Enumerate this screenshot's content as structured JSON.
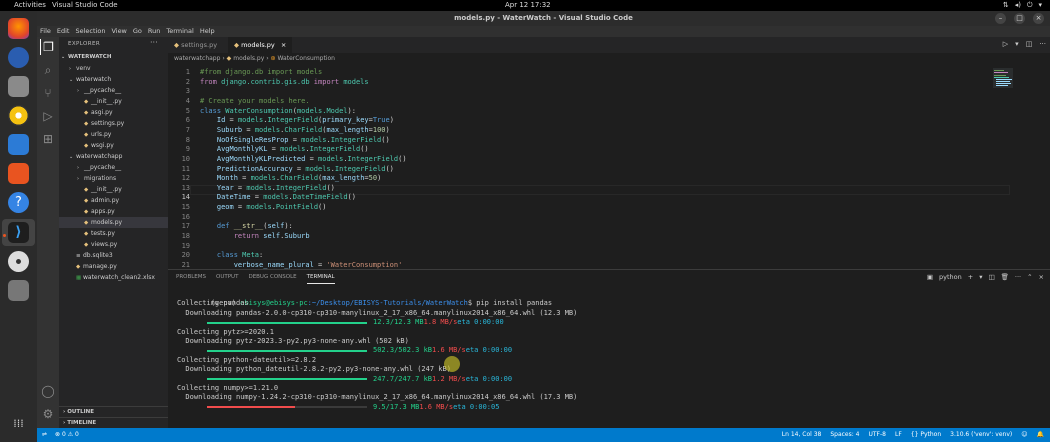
{
  "gnome": {
    "activities": "Activities",
    "app_name": "Visual Studio Code",
    "clock": "Apr 12  17:32"
  },
  "window": {
    "title": "models.py - WaterWatch - Visual Studio Code"
  },
  "menu": [
    "File",
    "Edit",
    "Selection",
    "View",
    "Go",
    "Run",
    "Terminal",
    "Help"
  ],
  "sidebar": {
    "title": "EXPLORER",
    "items": [
      {
        "label": "WATERWATCH",
        "chevron": "v",
        "indent": 0,
        "bold": true
      },
      {
        "label": "venv",
        "chevron": ">",
        "indent": 1
      },
      {
        "label": "waterwatch",
        "chevron": "v",
        "indent": 1
      },
      {
        "label": "__pycache__",
        "chevron": ">",
        "indent": 2
      },
      {
        "label": "__init__.py",
        "icon": "py",
        "indent": 2
      },
      {
        "label": "asgi.py",
        "icon": "py",
        "indent": 2
      },
      {
        "label": "settings.py",
        "icon": "py",
        "indent": 2
      },
      {
        "label": "urls.py",
        "icon": "py",
        "indent": 2
      },
      {
        "label": "wsgi.py",
        "icon": "py",
        "indent": 2
      },
      {
        "label": "waterwatchapp",
        "chevron": "v",
        "indent": 1
      },
      {
        "label": "__pycache__",
        "chevron": ">",
        "indent": 2
      },
      {
        "label": "migrations",
        "chevron": ">",
        "indent": 2
      },
      {
        "label": "__init__.py",
        "icon": "py",
        "indent": 2
      },
      {
        "label": "admin.py",
        "icon": "py",
        "indent": 2
      },
      {
        "label": "apps.py",
        "icon": "py",
        "indent": 2
      },
      {
        "label": "models.py",
        "icon": "py",
        "indent": 2,
        "selected": true
      },
      {
        "label": "tests.py",
        "icon": "py",
        "indent": 2
      },
      {
        "label": "views.py",
        "icon": "py",
        "indent": 2
      },
      {
        "label": "db.sqlite3",
        "icon": "db",
        "indent": 1
      },
      {
        "label": "manage.py",
        "icon": "py",
        "indent": 1
      },
      {
        "label": "waterwatch_clean2.xlsx",
        "icon": "xlsx",
        "indent": 1
      }
    ],
    "outline": "OUTLINE",
    "timeline": "TIMELINE"
  },
  "tabs": [
    {
      "label": "settings.py",
      "active": false
    },
    {
      "label": "models.py",
      "active": true
    }
  ],
  "breadcrumb": [
    "waterwatchapp",
    "models.py",
    "WaterConsumption"
  ],
  "code": [
    [
      [
        "cmt",
        "#from django.db import models"
      ]
    ],
    [
      [
        "k1",
        "from "
      ],
      [
        "cls",
        "django.contrib.gis.db"
      ],
      [
        "k1",
        " import "
      ],
      [
        "cls",
        "models"
      ]
    ],
    [],
    [
      [
        "cmt",
        "# Create your models here."
      ]
    ],
    [
      [
        "k2",
        "class "
      ],
      [
        "cls",
        "WaterConsumption"
      ],
      [
        "pl",
        "("
      ],
      [
        "cls",
        "models.Model"
      ],
      [
        "pl",
        "):"
      ]
    ],
    [
      [
        "pl",
        "    "
      ],
      [
        "var",
        "Id"
      ],
      [
        "pl",
        " = "
      ],
      [
        "cls",
        "models"
      ],
      [
        "pl",
        "."
      ],
      [
        "cls",
        "IntegerField"
      ],
      [
        "pl",
        "("
      ],
      [
        "var",
        "primary_key"
      ],
      [
        "pl",
        "="
      ],
      [
        "k2",
        "True"
      ],
      [
        "pl",
        ")"
      ]
    ],
    [
      [
        "pl",
        "    "
      ],
      [
        "var",
        "Suburb"
      ],
      [
        "pl",
        " = "
      ],
      [
        "cls",
        "models"
      ],
      [
        "pl",
        "."
      ],
      [
        "cls",
        "CharField"
      ],
      [
        "pl",
        "("
      ],
      [
        "var",
        "max_length"
      ],
      [
        "pl",
        "="
      ],
      [
        "num",
        "100"
      ],
      [
        "pl",
        ")"
      ]
    ],
    [
      [
        "pl",
        "    "
      ],
      [
        "var",
        "NoOfSingleResProp"
      ],
      [
        "pl",
        " = "
      ],
      [
        "cls",
        "models"
      ],
      [
        "pl",
        "."
      ],
      [
        "cls",
        "IntegerField"
      ],
      [
        "pl",
        "()"
      ]
    ],
    [
      [
        "pl",
        "    "
      ],
      [
        "var",
        "AvgMonthlyKL"
      ],
      [
        "pl",
        " = "
      ],
      [
        "cls",
        "models"
      ],
      [
        "pl",
        "."
      ],
      [
        "cls",
        "IntegerField"
      ],
      [
        "pl",
        "()"
      ]
    ],
    [
      [
        "pl",
        "    "
      ],
      [
        "var",
        "AvgMonthlyKLPredicted"
      ],
      [
        "pl",
        " = "
      ],
      [
        "cls",
        "models"
      ],
      [
        "pl",
        "."
      ],
      [
        "cls",
        "IntegerField"
      ],
      [
        "pl",
        "()"
      ]
    ],
    [
      [
        "pl",
        "    "
      ],
      [
        "var",
        "PredictionAccuracy"
      ],
      [
        "pl",
        " = "
      ],
      [
        "cls",
        "models"
      ],
      [
        "pl",
        "."
      ],
      [
        "cls",
        "IntegerField"
      ],
      [
        "pl",
        "()"
      ]
    ],
    [
      [
        "pl",
        "    "
      ],
      [
        "var",
        "Month"
      ],
      [
        "pl",
        " = "
      ],
      [
        "cls",
        "models"
      ],
      [
        "pl",
        "."
      ],
      [
        "cls",
        "CharField"
      ],
      [
        "pl",
        "("
      ],
      [
        "var",
        "max_length"
      ],
      [
        "pl",
        "="
      ],
      [
        "num",
        "50"
      ],
      [
        "pl",
        ")"
      ]
    ],
    [
      [
        "pl",
        "    "
      ],
      [
        "var",
        "Year"
      ],
      [
        "pl",
        " = "
      ],
      [
        "cls",
        "models"
      ],
      [
        "pl",
        "."
      ],
      [
        "cls",
        "IntegerField"
      ],
      [
        "pl",
        "()"
      ]
    ],
    [
      [
        "pl",
        "    "
      ],
      [
        "var",
        "DateTime"
      ],
      [
        "pl",
        " = "
      ],
      [
        "cls",
        "models"
      ],
      [
        "pl",
        "."
      ],
      [
        "cls",
        "DateTimeField"
      ],
      [
        "pl",
        "()"
      ]
    ],
    [
      [
        "pl",
        "    "
      ],
      [
        "var",
        "geom"
      ],
      [
        "pl",
        " = "
      ],
      [
        "cls",
        "models"
      ],
      [
        "pl",
        "."
      ],
      [
        "cls",
        "PointField"
      ],
      [
        "pl",
        "()"
      ]
    ],
    [],
    [
      [
        "pl",
        "    "
      ],
      [
        "k2",
        "def "
      ],
      [
        "fn",
        "__str__"
      ],
      [
        "pl",
        "("
      ],
      [
        "var",
        "self"
      ],
      [
        "pl",
        "):"
      ]
    ],
    [
      [
        "pl",
        "        "
      ],
      [
        "k1",
        "return "
      ],
      [
        "var",
        "self"
      ],
      [
        "pl",
        "."
      ],
      [
        "var",
        "Suburb"
      ]
    ],
    [],
    [
      [
        "pl",
        "    "
      ],
      [
        "k2",
        "class "
      ],
      [
        "cls",
        "Meta"
      ],
      [
        "pl",
        ":"
      ]
    ],
    [
      [
        "pl",
        "        "
      ],
      [
        "var",
        "verbose_name_plural"
      ],
      [
        "pl",
        " = "
      ],
      [
        "str",
        "'WaterConsumption'"
      ]
    ]
  ],
  "active_line": 14,
  "panel": {
    "tabs": [
      "PROBLEMS",
      "OUTPUT",
      "DEBUG CONSOLE",
      "TERMINAL"
    ],
    "active_tab": "TERMINAL",
    "terminal_name": "python"
  },
  "terminal": {
    "prompt_env": "(venv) ",
    "prompt_user": "ebisys@ebisys-pc",
    "prompt_path": ":~/Desktop/EBISYS-Tutorials/WaterWatch",
    "command": "$ pip install pandas",
    "lines": [
      {
        "kind": "text",
        "text": "Collecting pandas"
      },
      {
        "kind": "text",
        "text": "  Downloading pandas-2.0.0-cp310-cp310-manylinux_2_17_x86_64.manylinux2014_x86_64.whl (12.3 MB)"
      },
      {
        "kind": "progress",
        "fraction": 1.0,
        "bar_color": "#23d18b",
        "size": "12.3/12.3 MB",
        "speed": "1.8 MB/s",
        "eta": "eta 0:00:00"
      },
      {
        "kind": "text",
        "text": "Collecting pytz>=2020.1"
      },
      {
        "kind": "text",
        "text": "  Downloading pytz-2023.3-py2.py3-none-any.whl (502 kB)"
      },
      {
        "kind": "progress",
        "fraction": 1.0,
        "bar_color": "#23d18b",
        "size": "502.3/502.3 kB",
        "speed": "1.6 MB/s",
        "eta": "eta 0:00:00"
      },
      {
        "kind": "text",
        "text": "Collecting python-dateutil>=2.8.2"
      },
      {
        "kind": "text",
        "text": "  Downloading python_dateutil-2.8.2-py2.py3-none-any.whl (247 kB)"
      },
      {
        "kind": "progress",
        "fraction": 1.0,
        "bar_color": "#23d18b",
        "size": "247.7/247.7 kB",
        "speed": "1.2 MB/s",
        "eta": "eta 0:00:00"
      },
      {
        "kind": "text",
        "text": "Collecting numpy>=1.21.0"
      },
      {
        "kind": "text",
        "text": "  Downloading numpy-1.24.2-cp310-cp310-manylinux_2_17_x86_64.manylinux2014_x86_64.whl (17.3 MB)"
      },
      {
        "kind": "progress",
        "fraction": 0.55,
        "bar_color": "#f14c4c",
        "size": "9.5/17.3 MB",
        "speed": "1.6 MB/s",
        "eta": "eta 0:00:05"
      }
    ]
  },
  "status": {
    "position": "Ln 14, Col 38",
    "spaces": "Spaces: 4",
    "encoding": "UTF-8",
    "eol": "LF",
    "language": "Python",
    "interpreter": "3.10.6 ('venv': venv)"
  },
  "colors": {
    "statusbar": "#007acc",
    "accent": "#e95420"
  }
}
